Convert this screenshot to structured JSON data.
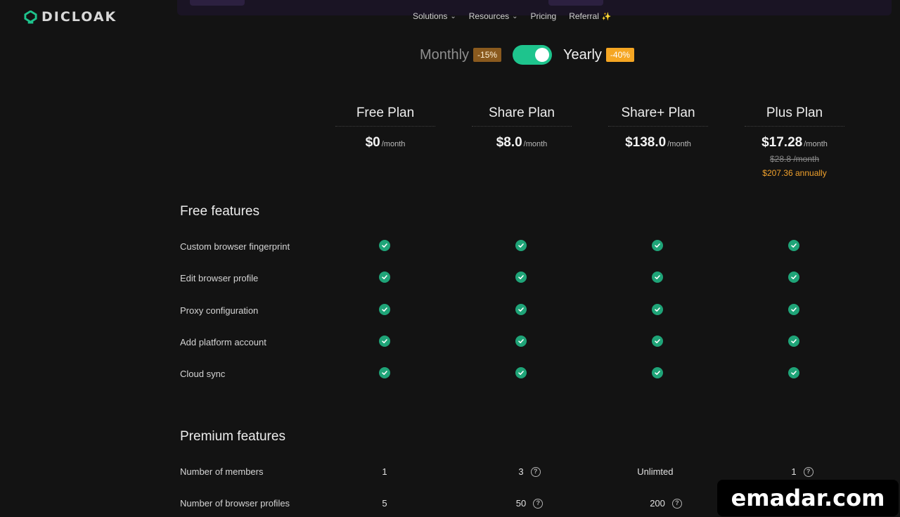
{
  "brand": {
    "name": "DICLOAK",
    "accent": "#1ec48d"
  },
  "nav": {
    "items": [
      {
        "label": "Solutions",
        "has_dropdown": true
      },
      {
        "label": "Resources",
        "has_dropdown": true
      },
      {
        "label": "Pricing",
        "has_dropdown": false
      },
      {
        "label": "Referral",
        "has_dropdown": false,
        "icon": "sparkle-icon"
      }
    ]
  },
  "billing": {
    "monthly_label": "Monthly",
    "monthly_badge": "-15%",
    "yearly_label": "Yearly",
    "yearly_badge": "-40%",
    "selected": "Yearly"
  },
  "plans": [
    {
      "name": "Free Plan",
      "price": "$0",
      "period": "/month"
    },
    {
      "name": "Share Plan",
      "price": "$8.0",
      "period": "/month"
    },
    {
      "name": "Share+ Plan",
      "price": "$138.0",
      "period": "/month"
    },
    {
      "name": "Plus Plan",
      "price": "$17.28",
      "period": "/month",
      "old_price": "$28.8 /month",
      "annual": "$207.36 annually"
    }
  ],
  "free_features": {
    "title": "Free features",
    "rows": [
      {
        "label": "Custom browser fingerprint",
        "values": [
          true,
          true,
          true,
          true
        ]
      },
      {
        "label": "Edit browser profile",
        "values": [
          true,
          true,
          true,
          true
        ]
      },
      {
        "label": "Proxy configuration",
        "values": [
          true,
          true,
          true,
          true
        ]
      },
      {
        "label": "Add platform account",
        "values": [
          true,
          true,
          true,
          true
        ]
      },
      {
        "label": "Cloud sync",
        "values": [
          true,
          true,
          true,
          true
        ]
      }
    ]
  },
  "premium_features": {
    "title": "Premium features",
    "rows": [
      {
        "label": "Number of members",
        "values": [
          "1",
          "3",
          "Unlimted",
          "1"
        ],
        "help": [
          false,
          true,
          false,
          true
        ]
      },
      {
        "label": "Number of browser profiles",
        "values": [
          "5",
          "50",
          "200",
          ""
        ],
        "help": [
          false,
          true,
          true,
          false
        ]
      }
    ]
  },
  "watermark": "emadar.com"
}
